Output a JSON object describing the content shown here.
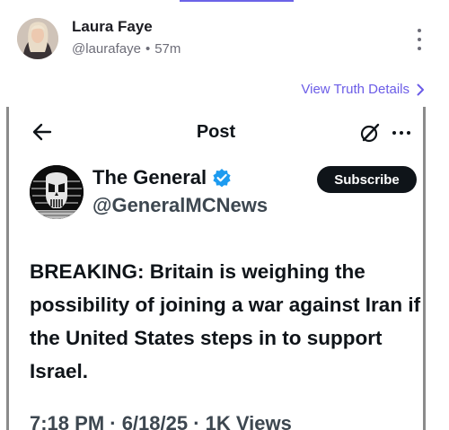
{
  "truth_post": {
    "author_name": "Laura Faye",
    "author_handle": "@laurafaye",
    "separator": "•",
    "time_ago": "57m",
    "view_details_label": "View Truth Details",
    "view_details_chevron": "chevron-right-icon"
  },
  "embedded_post": {
    "header_title": "Post",
    "display_name": "The General",
    "verified_badge_color": "#1d9bf0",
    "username": "@GeneralMCNews",
    "subscribe_label": "Subscribe",
    "body": "BREAKING: Britain is weighing the possibility of joining a war against Iran if the United States steps in to support Israel.",
    "meta": "7:18 PM · 6/18/25 · 1K Views"
  },
  "colors": {
    "accent": "#6b5ce7",
    "text_primary": "#0f1419",
    "text_secondary": "#6d6d78",
    "subscribe_bg": "#0f1419"
  }
}
